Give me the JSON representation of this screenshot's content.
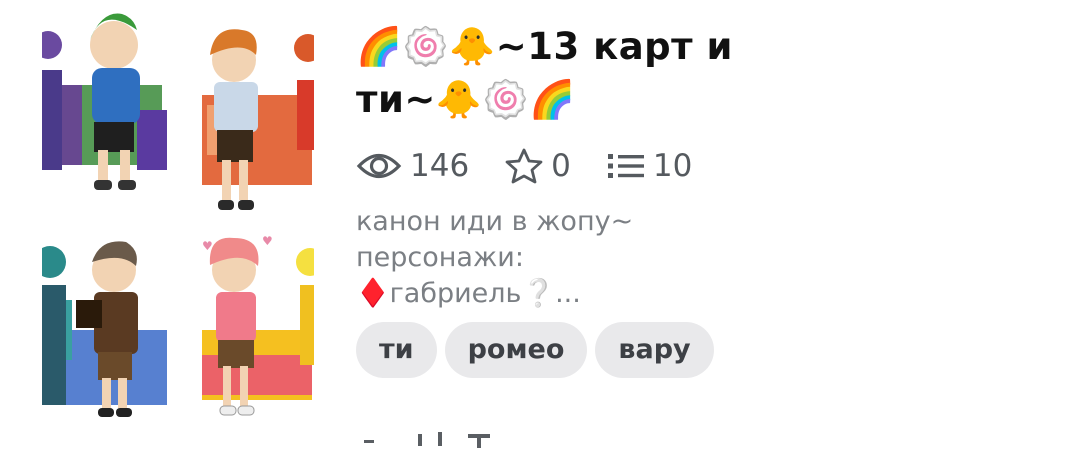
{
  "post": {
    "title_line1": "🌈🍥🐥~13 карт и",
    "title_line2": "ти~🐥🍥🌈",
    "stats": {
      "views": "146",
      "likes": "0",
      "items": "10"
    },
    "description": {
      "line1": "канон иди в жопу~",
      "line2": "персонажи:",
      "line3": "♦️габриель❔..."
    },
    "tags": [
      "ти",
      "ромео",
      "вару"
    ]
  },
  "icons": {
    "views": "eye-icon",
    "likes": "star-icon",
    "items": "list-icon"
  },
  "colors": {
    "text_primary": "#111111",
    "text_secondary": "#7b7f84",
    "stat_text": "#555a5f",
    "tag_bg": "#e9e9eb"
  }
}
